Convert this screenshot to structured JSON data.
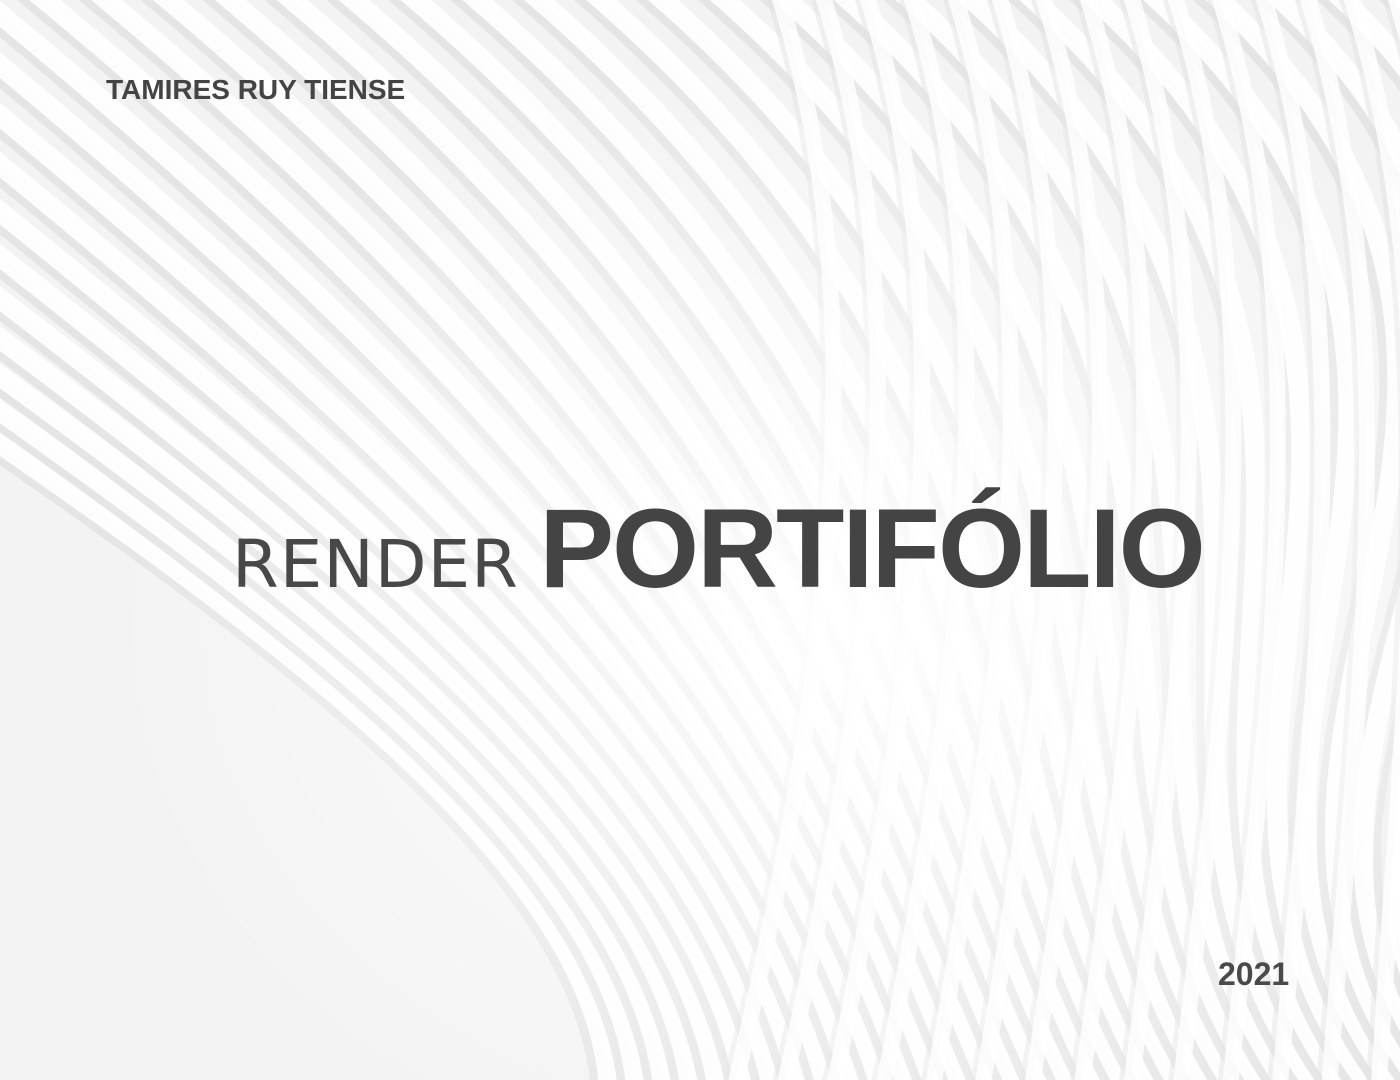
{
  "cover": {
    "author": "TAMIRES RUY TIENSE",
    "title_prefix": "RENDER",
    "title_main": "PORTIFÓLIO",
    "year": "2021"
  },
  "background": {
    "description_icon": "curved-ribs-pattern",
    "base_color": "#f4f4f4",
    "highlight_color": "#ffffff",
    "shadow_color": "#e2e2e2"
  },
  "text_color": "#444444"
}
